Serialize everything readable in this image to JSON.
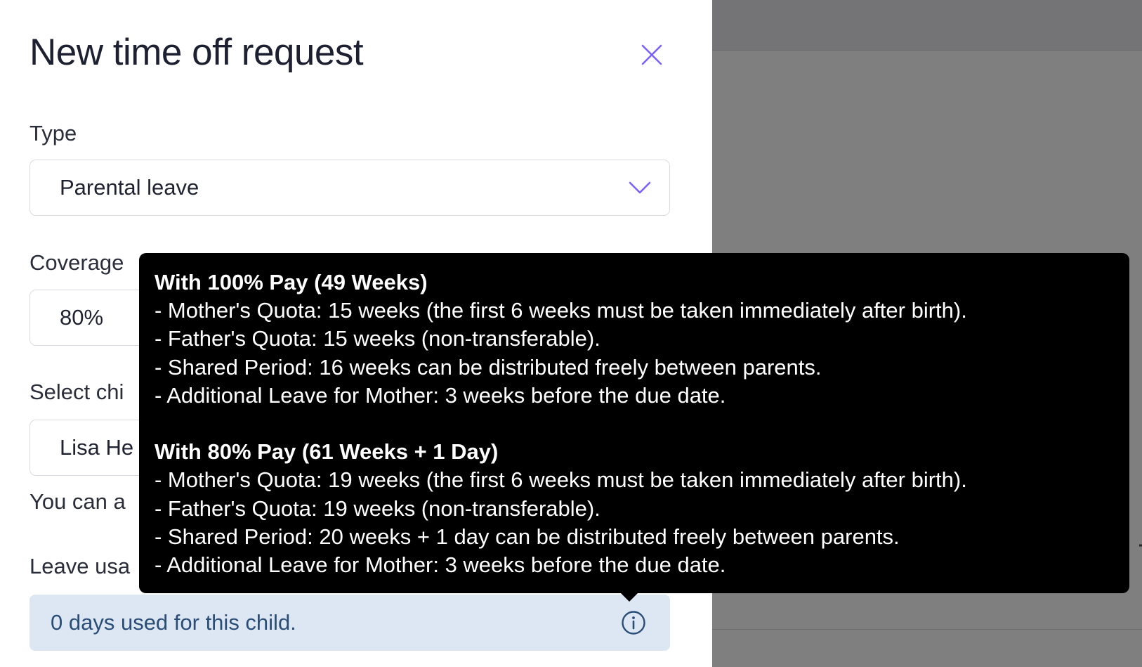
{
  "panel": {
    "title": "New time off request"
  },
  "fields": {
    "type": {
      "label": "Type",
      "value": "Parental leave"
    },
    "coverage": {
      "label": "Coverage",
      "value": "80%"
    },
    "child": {
      "label": "Select chi",
      "value": "Lisa He"
    },
    "helper_text": "You can a",
    "usage": {
      "label": "Leave usa",
      "info_text": "0 days used for this child."
    }
  },
  "tooltip": {
    "section1": {
      "heading": "With 100% Pay (49 Weeks)",
      "lines": [
        "- Mother's Quota: 15 weeks (the first 6 weeks must be taken immediately after birth).",
        "- Father's Quota: 15 weeks (non-transferable).",
        "- Shared Period: 16 weeks can be distributed freely between parents.",
        "- Additional Leave for Mother: 3 weeks before the due date."
      ]
    },
    "section2": {
      "heading": "With 80% Pay (61 Weeks + 1 Day)",
      "lines": [
        "- Mother's Quota: 19 weeks (the first 6 weeks must be taken immediately after birth).",
        "- Father's Quota: 19 weeks (non-transferable).",
        "- Shared Period: 20 weeks + 1 day can be distributed freely between parents.",
        "- Additional Leave for Mother: 3 weeks before the due date."
      ]
    }
  },
  "icons": {
    "close": "close-icon",
    "chevron": "chevron-down-icon",
    "info": "info-icon"
  },
  "colors": {
    "accent": "#7b61ff",
    "info_bg": "#dde7f3",
    "info_text": "#2a4d77",
    "tooltip_bg": "#000000",
    "backdrop": "#7f7f80"
  }
}
